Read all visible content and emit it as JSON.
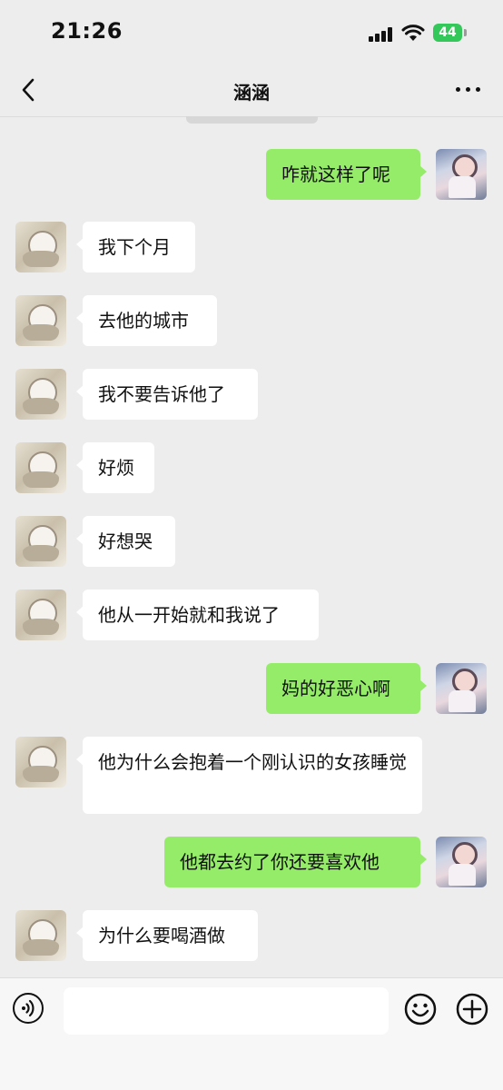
{
  "status_bar": {
    "time": "21:26",
    "battery": "44"
  },
  "nav": {
    "title": "涵涵"
  },
  "messages": [
    {
      "side": "out",
      "text": "咋就这样了呢"
    },
    {
      "side": "in",
      "text": "我下个月"
    },
    {
      "side": "in",
      "text": "去他的城市"
    },
    {
      "side": "in",
      "text": "我不要告诉他了"
    },
    {
      "side": "in",
      "text": "好烦"
    },
    {
      "side": "in",
      "text": "好想哭"
    },
    {
      "side": "in",
      "text": "他从一开始就和我说了"
    },
    {
      "side": "out",
      "text": "妈的好恶心啊"
    },
    {
      "side": "in",
      "text": "他为什么会抱着一个刚认识的女孩睡觉"
    },
    {
      "side": "out",
      "text": "他都去约了你还要喜欢他"
    },
    {
      "side": "in",
      "text": "为什么要喝酒做"
    }
  ],
  "input": {
    "value": "",
    "placeholder": ""
  },
  "colors": {
    "background": "#ededed",
    "out_bubble": "#95ec69",
    "in_bubble": "#ffffff",
    "battery": "#34c759"
  },
  "icons": [
    "back-icon",
    "more-icon",
    "voice-icon",
    "emoji-icon",
    "plus-icon"
  ]
}
